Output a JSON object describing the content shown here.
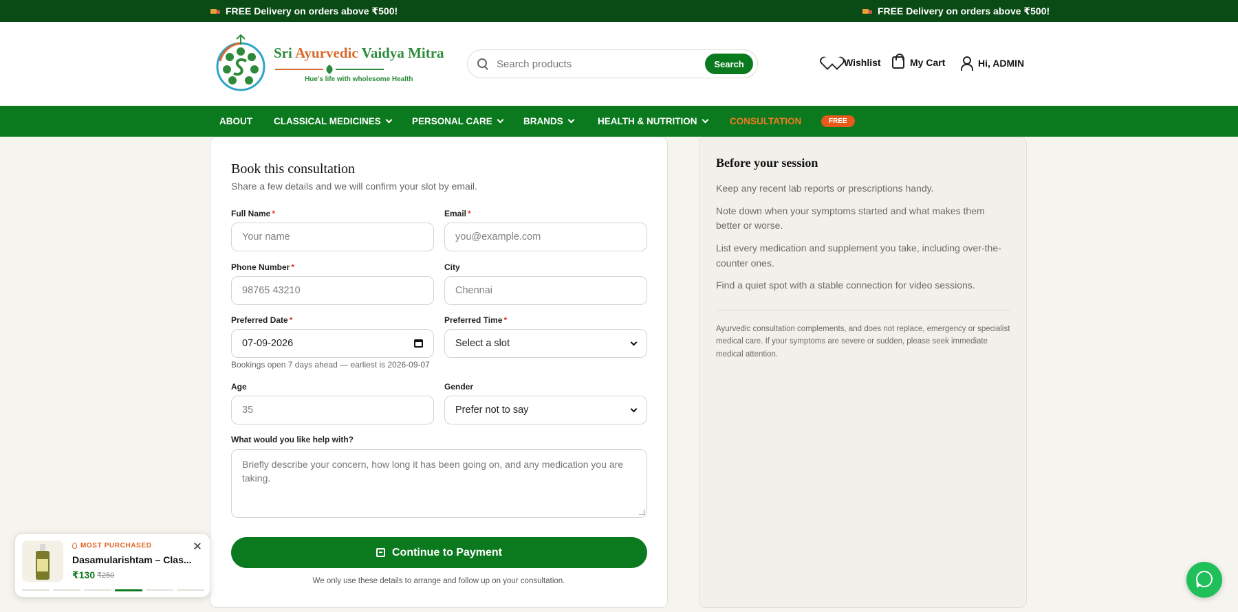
{
  "announcement": {
    "text_left": "FREE Delivery on orders above ₹500!",
    "text_right": "FREE Delivery on orders above ₹500!"
  },
  "logo": {
    "title_1": "Sri ",
    "title_2": "Ayurvedic ",
    "title_3": "Vaidya Mitra",
    "tagline": "Hue's life with wholesome Health"
  },
  "search": {
    "placeholder": "Search products",
    "button_label": "Search"
  },
  "header_actions": {
    "wishlist": "Wishlist",
    "cart": "My Cart",
    "user": "Hi, ADMIN"
  },
  "nav": {
    "about": "ABOUT",
    "classical": "CLASSICAL MEDICINES",
    "personal": "PERSONAL CARE",
    "brands": "BRANDS",
    "health": "HEALTH & NUTRITION",
    "consultation": "CONSULTATION",
    "badge": "FREE"
  },
  "form": {
    "title": "Book this consultation",
    "subtitle": "Share a few details and we will confirm your slot by email.",
    "full_name_label": "Full Name",
    "full_name_placeholder": "Your name",
    "email_label": "Email",
    "email_placeholder": "you@example.com",
    "phone_label": "Phone Number",
    "phone_placeholder": "98765 43210",
    "city_label": "City",
    "city_placeholder": "Chennai",
    "date_label": "Preferred Date",
    "date_value": "07-09-2026",
    "time_label": "Preferred Time",
    "time_value": "Select a slot",
    "date_hint": "Bookings open 7 days ahead — earliest is 2026-09-07",
    "age_label": "Age",
    "age_placeholder": "35",
    "gender_label": "Gender",
    "gender_value": "Prefer not to say",
    "help_label": "What would you like help with?",
    "help_placeholder": "Briefly describe your concern, how long it has been going on, and any medication you are taking.",
    "required_mark": "*",
    "submit_label": "Continue to Payment",
    "privacy_note": "We only use these details to arrange and follow up on your consultation."
  },
  "side": {
    "title": "Before your session",
    "tips": [
      "Keep any recent lab reports or prescriptions handy.",
      "Note down when your symptoms started and what makes them better or worse.",
      "List every medication and supplement you take, including over-the-counter ones.",
      "Find a quiet spot with a stable connection for video sessions."
    ],
    "disclaimer": "Ayurvedic consultation complements, and does not replace, emergency or specialist medical care. If your symptoms are severe or sudden, please seek immediate medical attention."
  },
  "popup": {
    "tag": "MOST PURCHASED",
    "product_name": "Dasamularishtam – Clas...",
    "price": "₹130",
    "old_price": "₹250",
    "active_slide_index": 3,
    "slide_count": 6
  },
  "colors": {
    "brand_green": "#0b7a1e",
    "dark_green": "#0a4a14",
    "accent_orange": "#f07a24",
    "required_red": "#d9382b",
    "whatsapp_green": "#1fbf5a"
  }
}
